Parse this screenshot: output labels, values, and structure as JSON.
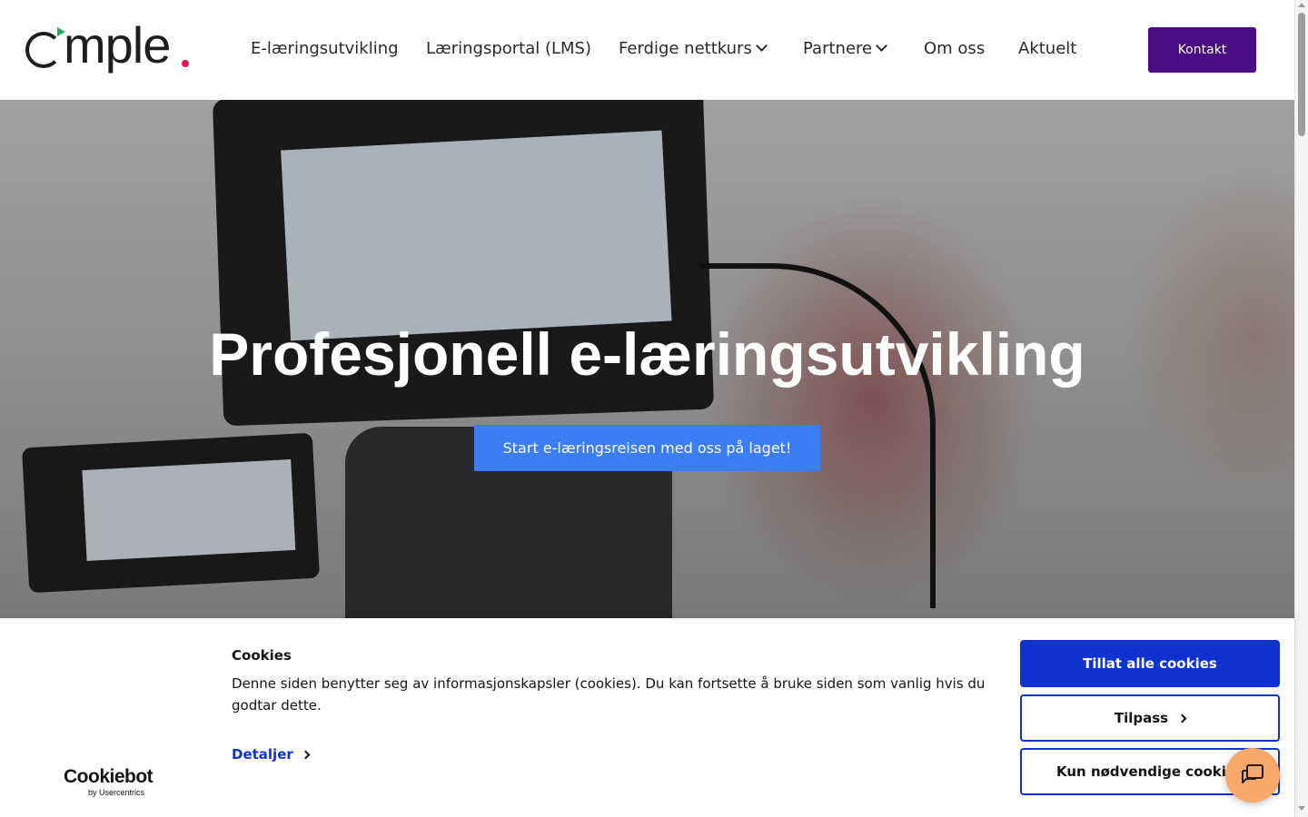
{
  "header": {
    "logo_text": "mple",
    "nav": [
      {
        "label": "E-læringsutvikling"
      },
      {
        "label": "Læringsportal (LMS)"
      },
      {
        "label": "Ferdige nettkurs"
      },
      {
        "label": "Partnere"
      },
      {
        "label": "Om oss"
      },
      {
        "label": "Aktuelt"
      }
    ],
    "contact_label": "Kontakt"
  },
  "hero": {
    "title": "Profesjonell e-læringsutvikling",
    "cta_label": "Start e-læringsreisen med oss på laget!"
  },
  "cookie_banner": {
    "brand_name": "Cookiebot",
    "brand_sub": "by Usercentrics",
    "title": "Cookies",
    "text": "Denne siden benytter seg av informasjonskapsler (cookies). Du kan fortsette å bruke siden som vanlig hvis du godtar dette.",
    "details_label": "Detaljer",
    "allow_all_label": "Tillat alle cookies",
    "customize_label": "Tilpass",
    "necessary_label": "Kun nødvendige cookies"
  },
  "colors": {
    "brand_purple": "#4b0b82",
    "cta_blue": "#3a7df5",
    "cookie_blue": "#1032cf",
    "logo_green": "#27a85b",
    "logo_red": "#e8174f",
    "chat_orange": "#f7a86b"
  },
  "icons": {
    "nav_dropdown": "chevron-down-icon",
    "details_arrow": "chevron-right-icon",
    "chat": "chat-bubble-icon"
  }
}
